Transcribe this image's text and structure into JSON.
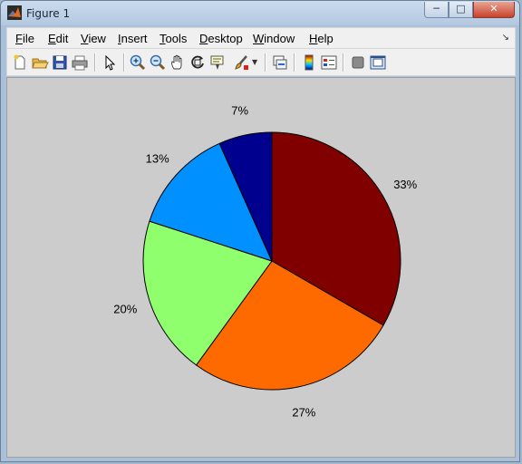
{
  "window": {
    "title": "Figure 1"
  },
  "menu": [
    "File",
    "Edit",
    "View",
    "Insert",
    "Tools",
    "Desktop",
    "Window",
    "Help"
  ],
  "menu_underline": [
    "F",
    "E",
    "V",
    "I",
    "T",
    "D",
    "W",
    "H"
  ],
  "toolbar": {
    "icons": [
      "new-figure-icon",
      "open-file-icon",
      "save-figure-icon",
      "print-figure-icon",
      "edit-plot-icon",
      "zoom-in-icon",
      "zoom-out-icon",
      "pan-icon",
      "rotate-3d-icon",
      "data-cursor-icon",
      "brush-icon",
      "link-plot-icon",
      "insert-colorbar-icon",
      "insert-legend-icon",
      "hide-plot-tools-icon",
      "show-plot-tools-icon"
    ]
  },
  "chart_data": {
    "type": "pie",
    "labels": [
      "33%",
      "27%",
      "20%",
      "13%",
      "7%"
    ],
    "values": [
      33.33,
      26.67,
      20,
      13.33,
      6.67
    ],
    "colors": [
      "#800000",
      "#ff6a00",
      "#90ff6e",
      "#0090ff",
      "#00008f"
    ],
    "start": "top",
    "direction": "clockwise"
  }
}
